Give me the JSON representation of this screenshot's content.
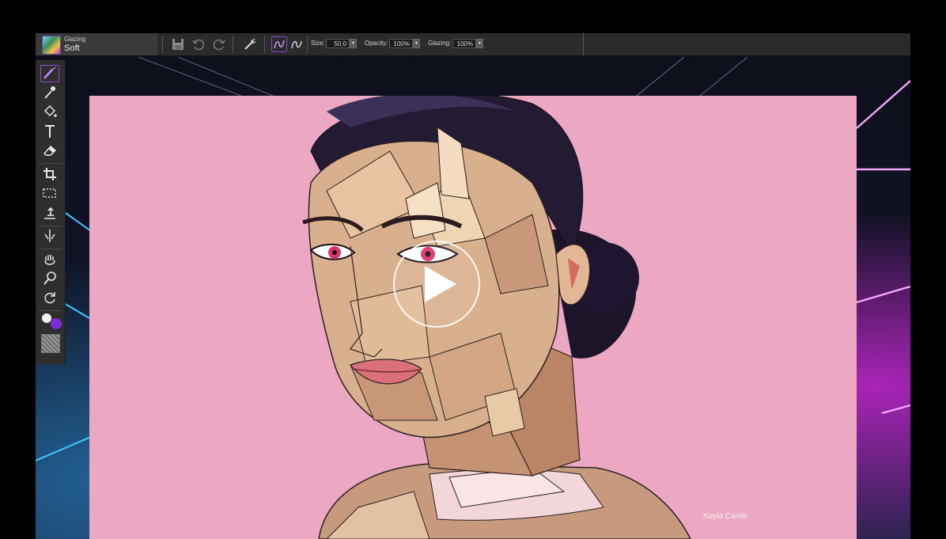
{
  "toolbar": {
    "brush_category": "Glazing",
    "brush_variant": "Soft",
    "size_label": "Size:",
    "size_value": "50.0",
    "opacity_label": "Opacity:",
    "opacity_value": "100%",
    "glazing_label": "Glazing:",
    "glazing_value": "100%",
    "icons": [
      "save-icon",
      "undo-icon",
      "redo-icon",
      "brush-tracking-icon",
      "stroke-attributes-icon",
      "stroke-mode-icon"
    ]
  },
  "toolbox": {
    "tools": [
      "brush-tool",
      "dropper-tool",
      "paint-bucket-tool",
      "text-tool",
      "eraser-tool",
      "crop-tool",
      "rectangle-select-tool",
      "transform-tool",
      "mirror-tool",
      "grabber-tool",
      "magnifier-tool",
      "rotate-page-tool"
    ],
    "main_color": "#7c2bd9",
    "secondary_color": "#f2f2f2"
  },
  "canvas": {
    "background_color": "#eca7c2",
    "signature": "Kayla Carlile"
  },
  "video": {
    "play_button": "play-icon"
  }
}
